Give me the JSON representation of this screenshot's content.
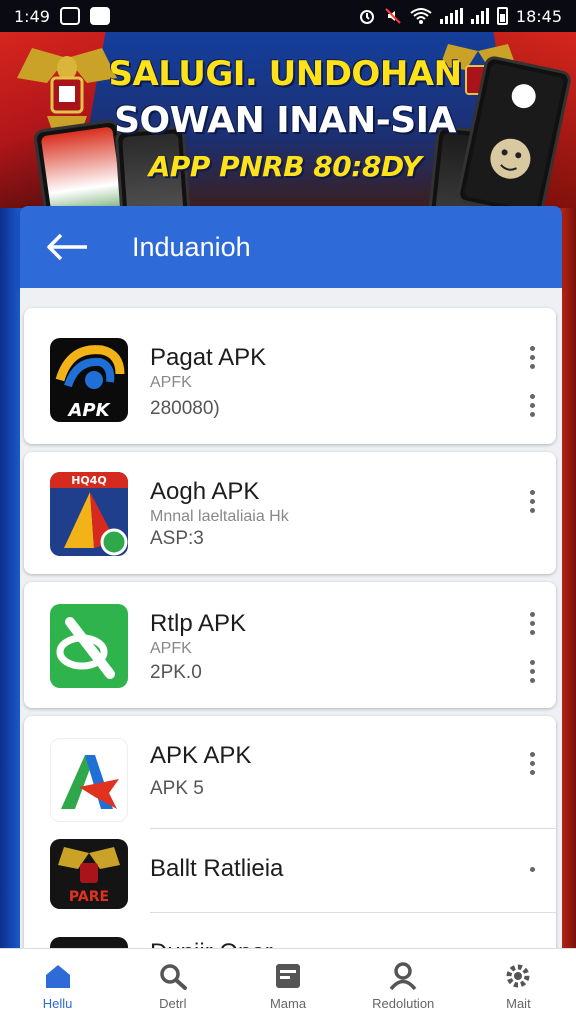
{
  "status_bar": {
    "time_left": "1:49",
    "time_right": "18:45"
  },
  "banner": {
    "line1": "SALUGI. UNDOHAN",
    "line2": "SOWAN INAN-SIA",
    "line3": "APP PNRB 80:8DY"
  },
  "appbar": {
    "title": "Induanioh",
    "back_icon": "arrow-left-icon"
  },
  "apps": [
    {
      "name": "Pagat APK",
      "sub": "APFK",
      "ver": "280080)",
      "icon_text": "APK"
    },
    {
      "name": "Aogh APK",
      "sub": "Mnnal laeltaliaia Hk",
      "ver": "ASP:3",
      "icon_text": "HQ4Q"
    },
    {
      "name": "Rtlp APK",
      "sub": "APFK",
      "ver": "2PK.0"
    },
    {
      "name": "APK APK",
      "sub": "",
      "ver": "APK 5"
    },
    {
      "name": "Ballt Ratlieia",
      "sub": "",
      "ver": "",
      "icon_text": "PARE"
    },
    {
      "name": "Duniir Oner",
      "sub": "",
      "ver": ""
    }
  ],
  "bottom_nav": [
    {
      "label": "Hellu",
      "icon": "home-icon",
      "active": true
    },
    {
      "label": "Detrl",
      "icon": "search-icon",
      "active": false
    },
    {
      "label": "Mama",
      "icon": "window-icon",
      "active": false
    },
    {
      "label": "Redolution",
      "icon": "person-icon",
      "active": false
    },
    {
      "label": "Mait",
      "icon": "gear-icon",
      "active": false
    }
  ],
  "colors": {
    "accent": "#2f6bd8",
    "banner_yellow": "#ffe21a",
    "flag_red": "#d7261e"
  }
}
